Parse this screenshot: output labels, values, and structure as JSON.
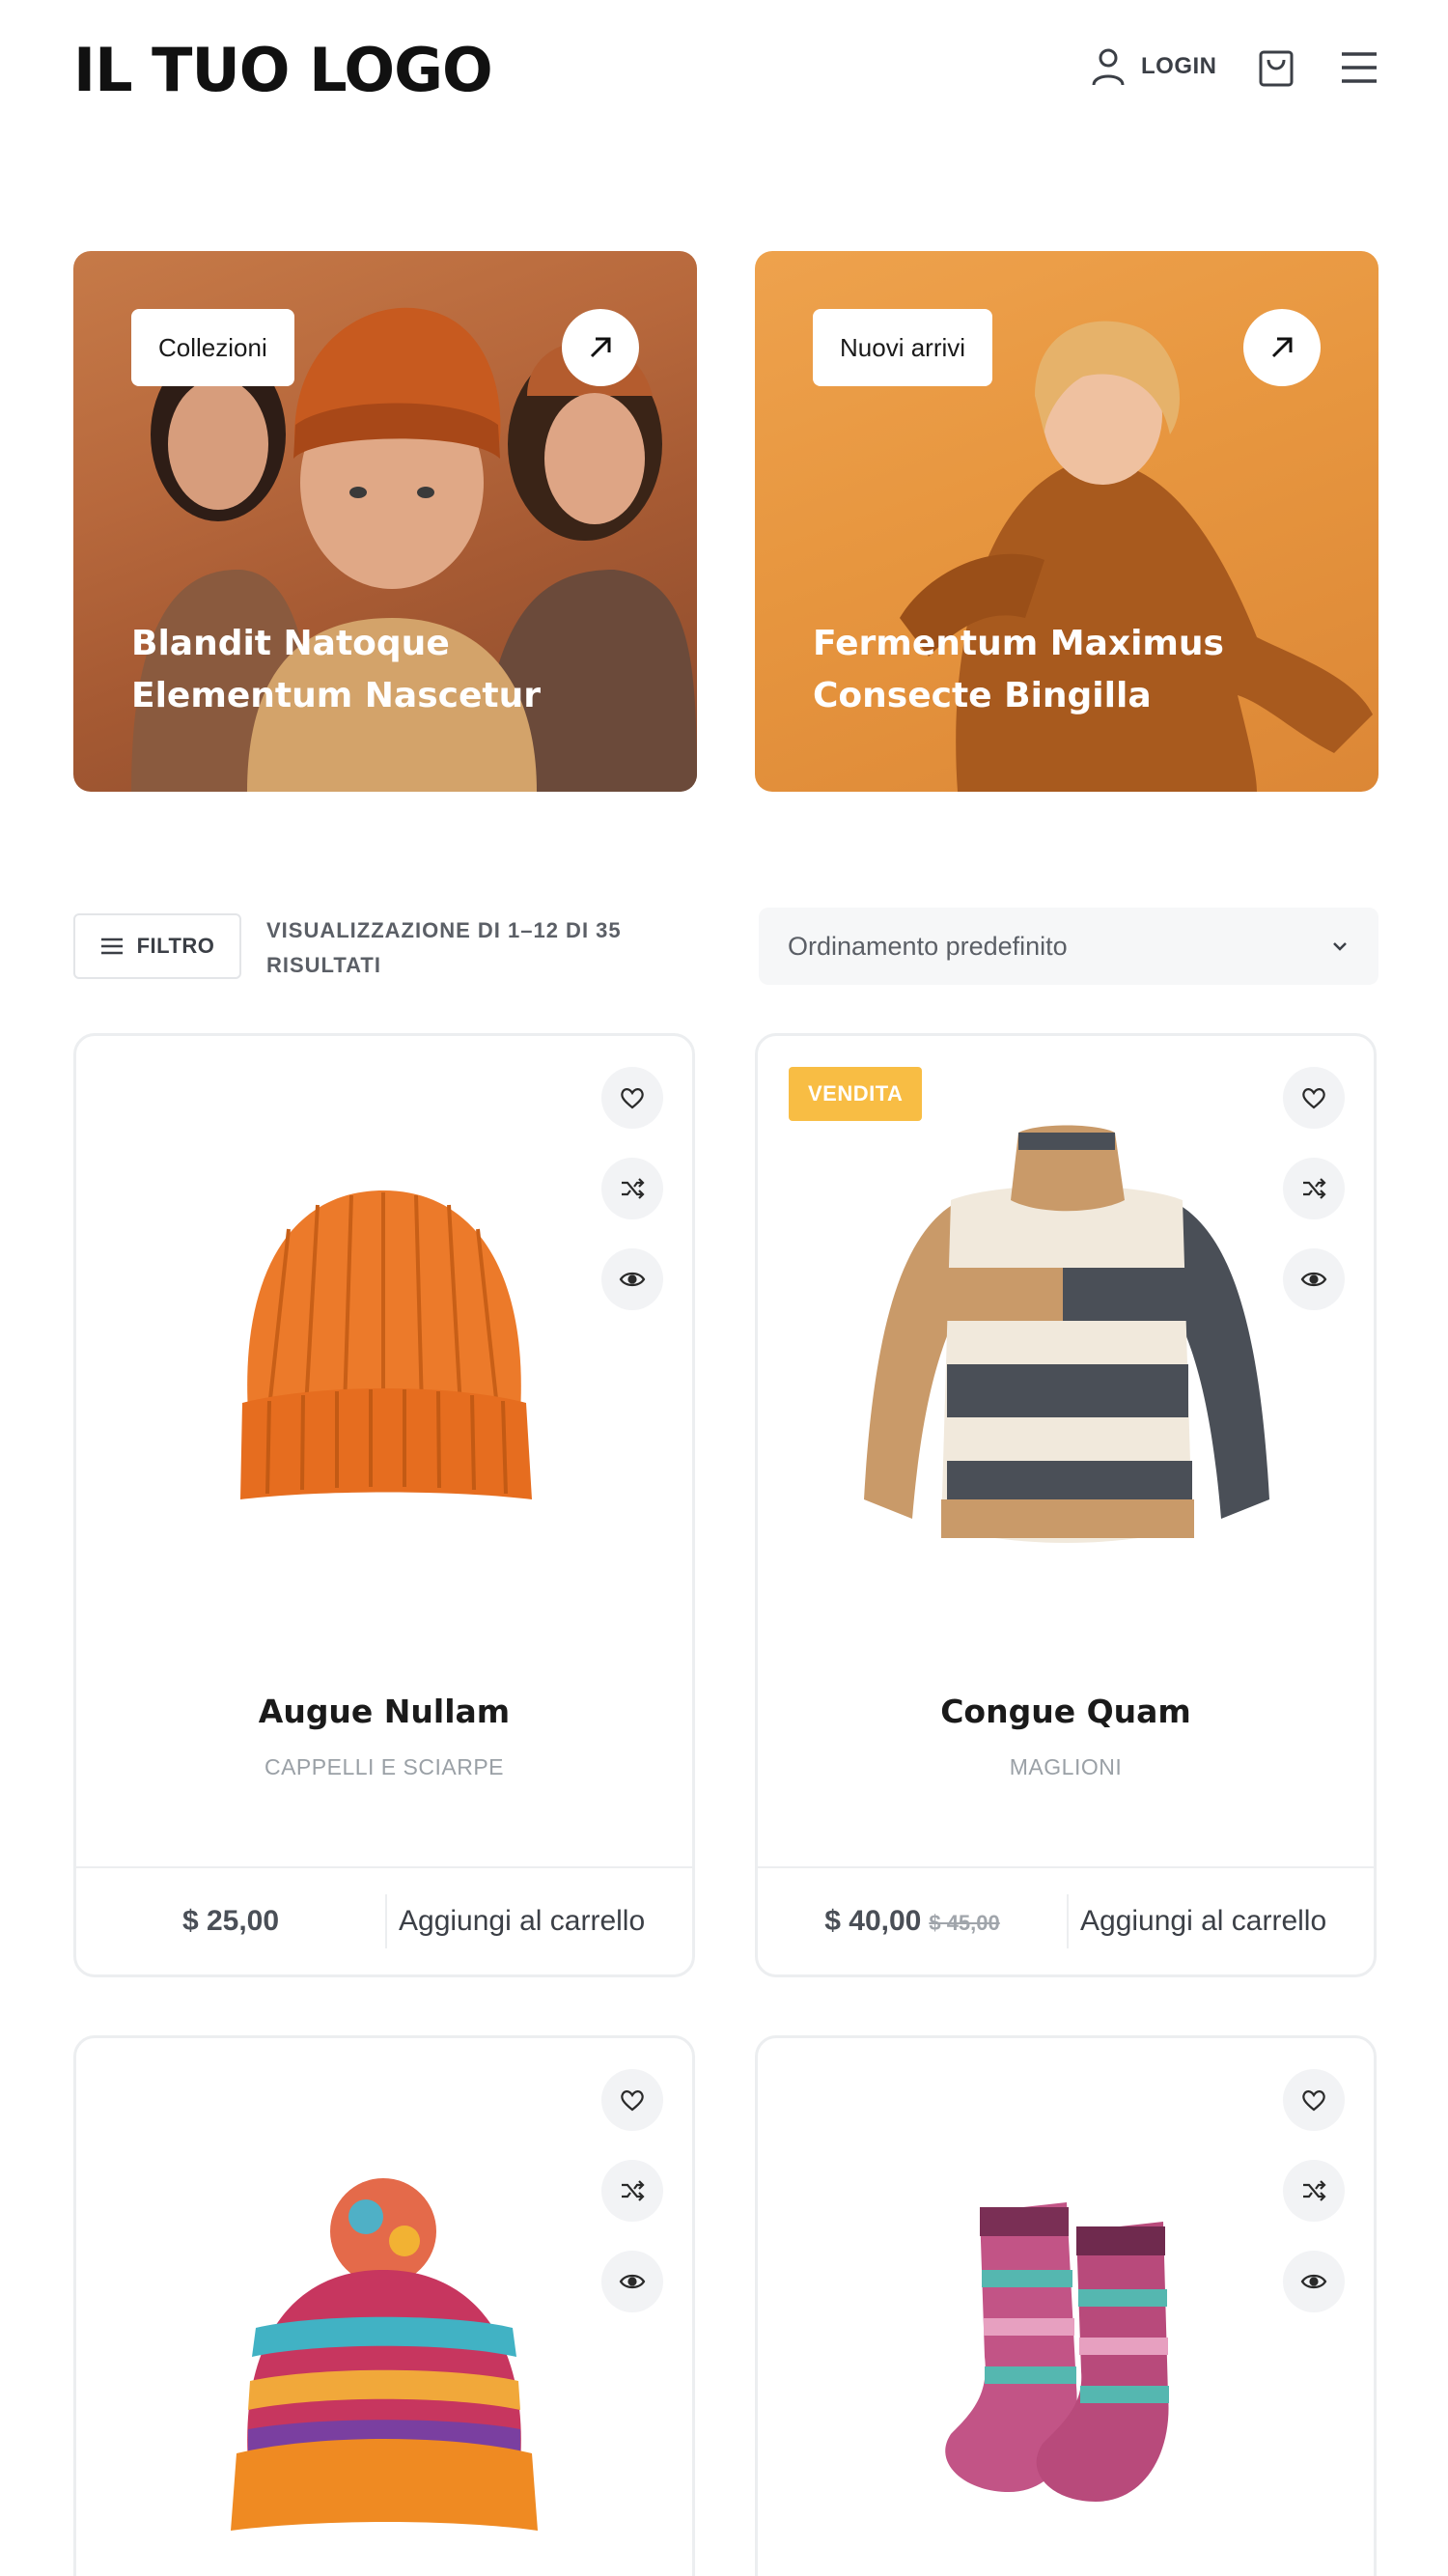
{
  "header": {
    "logo": "IL TUO LOGO",
    "login_label": "LOGIN"
  },
  "banners": [
    {
      "tag": "Collezioni",
      "title_line1": "Blandit Natoque",
      "title_line2": "Elementum Nascetur"
    },
    {
      "tag": "Nuovi arrivi",
      "title_line1": "Fermentum Maximus",
      "title_line2": "Consecte Bingilla"
    }
  ],
  "toolbar": {
    "filter_label": "FILTRO",
    "results_line1": "VISUALIZZAZIONE DI 1–12 DI 35",
    "results_line2": "RISULTATI",
    "sort_selected": "Ordinamento predefinito"
  },
  "products": [
    {
      "name": "Augue Nullam",
      "category": "CAPPELLI E SCIARPE",
      "price": "$ 25,00",
      "old_price": "",
      "add_label": "Aggiungi al carrello",
      "badge": ""
    },
    {
      "name": "Congue Quam",
      "category": "MAGLIONI",
      "price": "$ 40,00",
      "old_price": "$ 45,00",
      "add_label": "Aggiungi al carrello",
      "badge": "VENDITA"
    }
  ],
  "colors": {
    "sale_badge": "#f8bd44",
    "banner_1": "#b7683c",
    "banner_2": "#e7963f"
  }
}
